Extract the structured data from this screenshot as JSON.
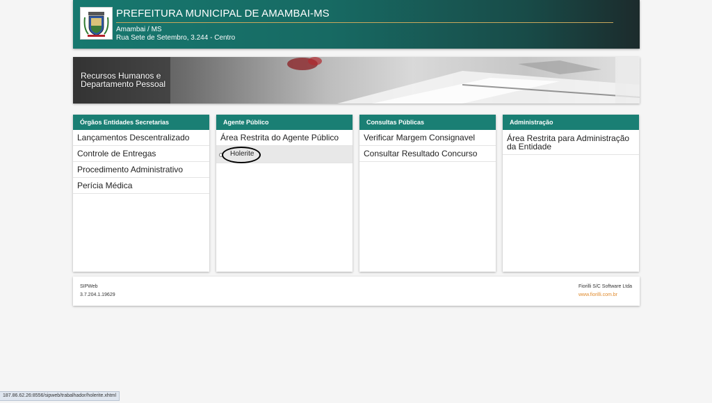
{
  "header": {
    "title": "PREFEITURA MUNICIPAL DE AMAMBAI-MS",
    "city": "Amambai / MS",
    "address": "Rua Sete de Setembro, 3.244 - Centro",
    "crest_icon": "municipal-crest-icon"
  },
  "banner": {
    "line1": "Recursos Humanos e",
    "line2": "Departamento Pessoal"
  },
  "cards": [
    {
      "title": "Órgãos Entidades Secretarias",
      "items": [
        "Lançamentos Descentralizado",
        "Controle de Entregas",
        "Procedimento Administrativo",
        "Perícia Médica"
      ]
    },
    {
      "title": "Agente Público",
      "items": [
        "Área Restrita do Agente Público"
      ],
      "subitems": [
        "Holerite"
      ]
    },
    {
      "title": "Consultas Públicas",
      "items": [
        "Verificar Margem Consignavel",
        "Consultar Resultado Concurso"
      ]
    },
    {
      "title": "Administração",
      "items": [
        "Área Restrita para Administração da Entidade"
      ]
    }
  ],
  "footer": {
    "app": "SIPWeb",
    "version": "3.7.204.1.19629",
    "company": "Fiorilli S/C Software Ltda",
    "website": "www.fiorilli.com.br"
  },
  "status_url": "187.86.62.26:8556/sipweb/trabalhador/holerite.xhtml",
  "colors": {
    "card_header": "#1a7f74",
    "link_orange": "#e08a2c",
    "header_gold_rule": "#c9a85c"
  }
}
